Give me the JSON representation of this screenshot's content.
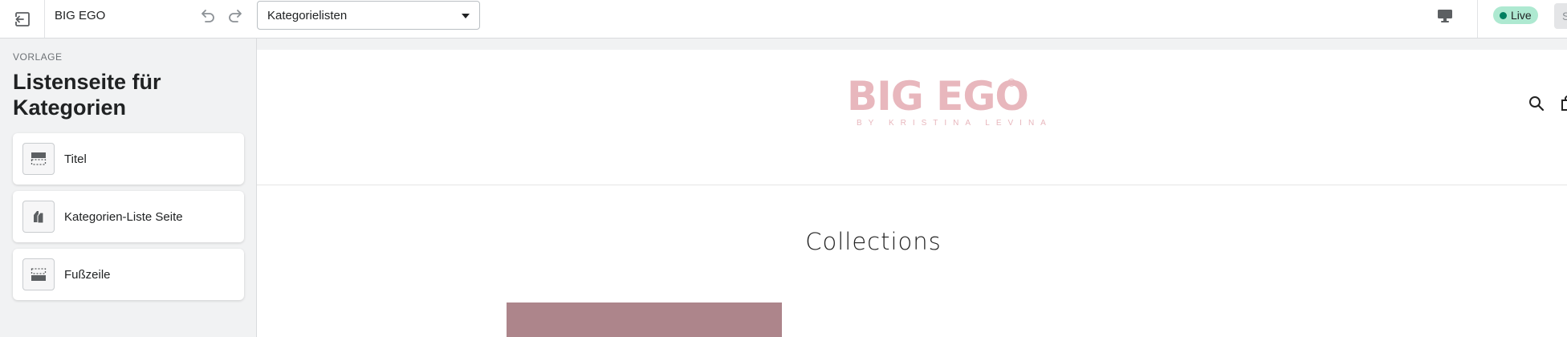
{
  "topbar": {
    "store_name": "BIG EGO",
    "template_select": {
      "value": "Kategorielisten"
    },
    "status_badge": "Live",
    "save_label": "S"
  },
  "sidebar": {
    "eyebrow": "VORLAGE",
    "title": "Listenseite für Kategorien",
    "sections": [
      {
        "label": "Titel",
        "icon": "header-section-icon"
      },
      {
        "label": "Kategorien-Liste Seite",
        "icon": "collection-tags-icon"
      },
      {
        "label": "Fußzeile",
        "icon": "footer-section-icon"
      }
    ]
  },
  "preview": {
    "logo": {
      "wordmark": "BIG EGO",
      "tagline": "BY KRISTINA LEVINA"
    },
    "heading": "Collections",
    "collection_card_color": "#ad858b"
  },
  "colors": {
    "accent_live": "#aee9d1",
    "live_dot": "#007f5f",
    "logo_pink": "#e8b7bd"
  }
}
